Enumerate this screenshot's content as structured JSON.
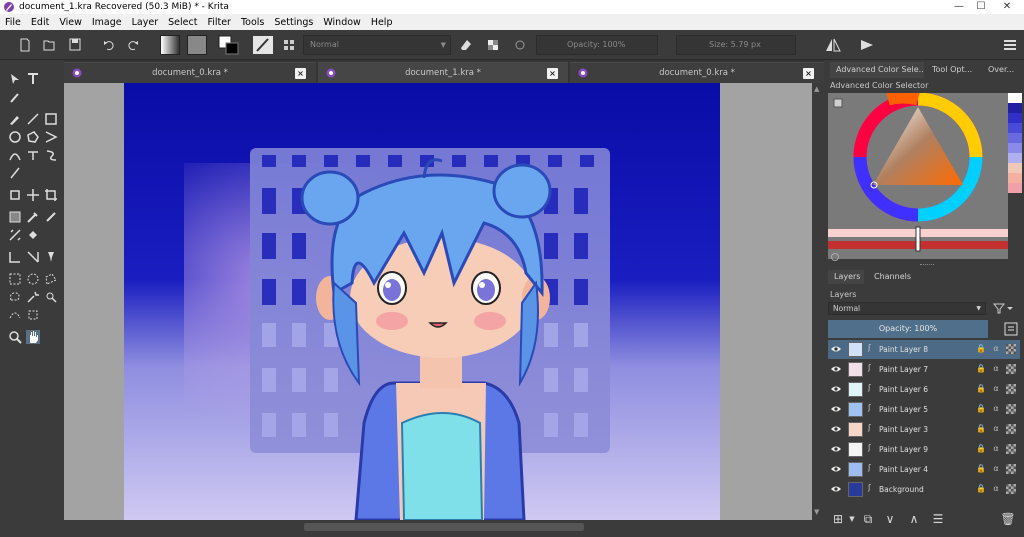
{
  "window": {
    "title": "document_1.kra Recovered  (50.3 MiB)  * - Krita",
    "controls": [
      "—",
      "☐",
      "✕"
    ]
  },
  "menu": [
    "File",
    "Edit",
    "View",
    "Image",
    "Layer",
    "Select",
    "Filter",
    "Tools",
    "Settings",
    "Window",
    "Help"
  ],
  "toolbar": {
    "blend_mode": "Normal",
    "opacity": "Opacity: 100%",
    "size": "Size: 5.79 px"
  },
  "tabs": [
    {
      "label": "document_0.kra *"
    },
    {
      "label": "document_1.kra *"
    },
    {
      "label": "document_0.kra *"
    }
  ],
  "dockers": {
    "tabs": [
      "Advanced Color Sele...",
      "Tool Opt...",
      "Over..."
    ],
    "color_selector_title": "Advanced Color Selector",
    "layer_tabs": [
      "Layers",
      "Channels"
    ],
    "layers_title": "Layers",
    "blend_mode": "Normal",
    "opacity": "Opacity:  100%",
    "layers": [
      {
        "name": "Paint Layer 8",
        "selected": true
      },
      {
        "name": "Paint Layer 7",
        "selected": false
      },
      {
        "name": "Paint Layer 6",
        "selected": false
      },
      {
        "name": "Paint Layer 5",
        "selected": false
      },
      {
        "name": "Paint Layer 3",
        "selected": false
      },
      {
        "name": "Paint Layer 9",
        "selected": false
      },
      {
        "name": "Paint Layer 4",
        "selected": false
      },
      {
        "name": "Background",
        "selected": false
      }
    ]
  },
  "colors": {
    "accent_selected": "#4c6a86",
    "canvas_top": "#0c0fb0",
    "canvas_bottom": "#c9c4ef"
  }
}
